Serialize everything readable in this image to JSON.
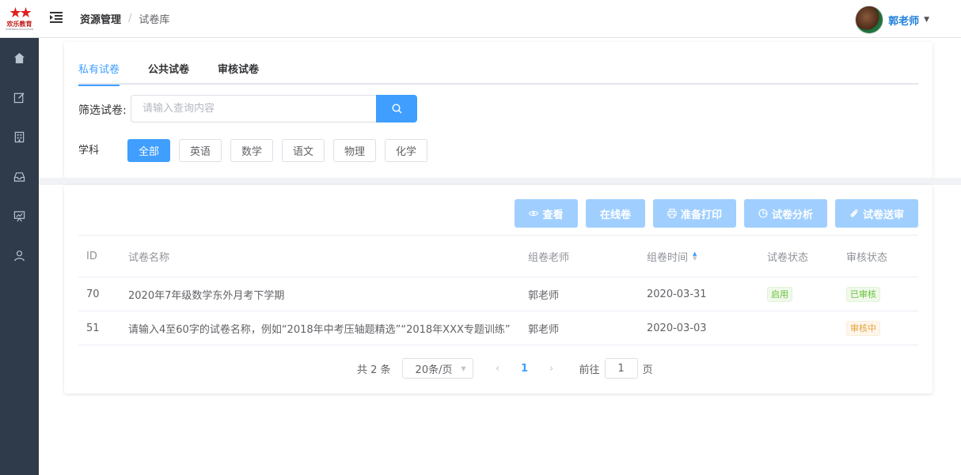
{
  "header": {
    "logo_text": "欢乐教育",
    "logo_subtext": "HAPPINESS EDUCATION",
    "breadcrumb": [
      "资源管理",
      "试卷库"
    ],
    "user_name": "郭老师"
  },
  "sidebar": {
    "items": [
      {
        "icon": "home-icon"
      },
      {
        "icon": "edit-icon"
      },
      {
        "icon": "building-icon"
      },
      {
        "icon": "inbox-icon"
      },
      {
        "icon": "presentation-icon"
      },
      {
        "icon": "user-icon"
      }
    ]
  },
  "tabs": [
    {
      "label": "私有试卷",
      "active": true
    },
    {
      "label": "公共试卷",
      "active": false
    },
    {
      "label": "审核试卷",
      "active": false
    }
  ],
  "filter": {
    "label": "筛选试卷:",
    "placeholder": "请输入查询内容"
  },
  "subjects": {
    "label": "学科",
    "items": [
      {
        "label": "全部",
        "active": true
      },
      {
        "label": "英语",
        "active": false
      },
      {
        "label": "数学",
        "active": false
      },
      {
        "label": "语文",
        "active": false
      },
      {
        "label": "物理",
        "active": false
      },
      {
        "label": "化学",
        "active": false
      }
    ]
  },
  "actions": [
    {
      "label": "查看",
      "icon": "eye-icon"
    },
    {
      "label": "在线卷",
      "icon": ""
    },
    {
      "label": "准备打印",
      "icon": "printer-icon"
    },
    {
      "label": "试卷分析",
      "icon": "pie-chart-icon"
    },
    {
      "label": "试卷送审",
      "icon": "paperclip-icon"
    }
  ],
  "table": {
    "columns": [
      "ID",
      "试卷名称",
      "组卷老师",
      "组卷时间",
      "试卷状态",
      "审核状态"
    ],
    "rows": [
      {
        "id": "70",
        "name": "2020年7年级数学东外月考下学期",
        "teacher": "郭老师",
        "time": "2020-03-31",
        "status": "启用",
        "review": "已审核"
      },
      {
        "id": "51",
        "name": "请输入4至60字的试卷名称，例如“2018年中考压轴题精选”“2018年XXX专题训练”",
        "teacher": "郭老师",
        "time": "2020-03-03",
        "status": "",
        "review": "审核中"
      }
    ]
  },
  "pagination": {
    "total": "共 2 条",
    "page_size": "20条/页",
    "current_page": "1",
    "goto_label": "前往",
    "goto_value": "1",
    "page_unit": "页"
  },
  "colors": {
    "primary": "#409eff",
    "primary_light": "#a0cfff",
    "sidebar_bg": "#2f3a4a",
    "success": "#67c23a",
    "warning": "#e6a23c"
  }
}
